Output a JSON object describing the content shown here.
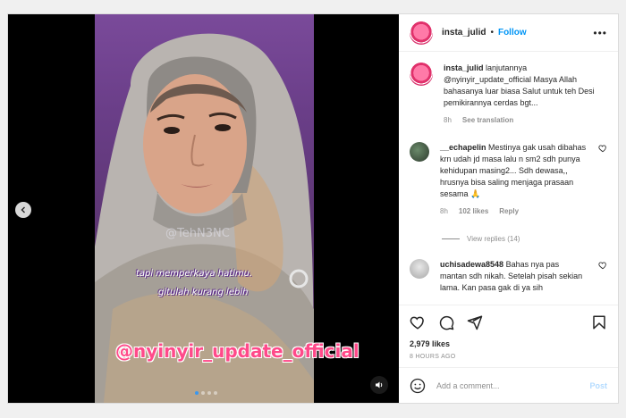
{
  "media": {
    "caption_line1": "tapi memperkaya hatimu.",
    "caption_line2": "gitulah kurang lebih",
    "watermark": "@TehN3NC",
    "handle_overlay": "@nyinyir_update_official",
    "slide_count": 4,
    "active_slide": 1
  },
  "header": {
    "username": "insta_julid",
    "separator": "•",
    "follow": "Follow",
    "more": "•••"
  },
  "caption": {
    "username": "insta_julid",
    "text": "lanjutannya @nyinyir_update_official Masya Allah bahasanya luar biasa Salut untuk teh Desi pemikirannya cerdas bgt...",
    "time": "8h",
    "see_translation": "See translation"
  },
  "comments": [
    {
      "username": "__echapelin",
      "text": "Mestinya gak usah dibahas krn udah jd masa lalu n sm2 sdh punya kehidupan masing2... Sdh dewasa,, hrusnya bisa saling menjaga prasaan sesama 🙏",
      "time": "8h",
      "likes": "102 likes",
      "reply": "Reply",
      "view_replies": "View replies (14)"
    },
    {
      "username": "uchisadewa8548",
      "text": "Bahas nya pas mantan sdh nikah. Setelah pisah sekian lama. Kan pasa gak di ya sih"
    }
  ],
  "post": {
    "likes": "2,979 likes",
    "timestamp": "8 HOURS AGO"
  },
  "add_comment": {
    "placeholder": "Add a comment...",
    "post": "Post"
  },
  "colors": {
    "accent": "#0095f6",
    "handle_pink": "#ff4a8a"
  }
}
